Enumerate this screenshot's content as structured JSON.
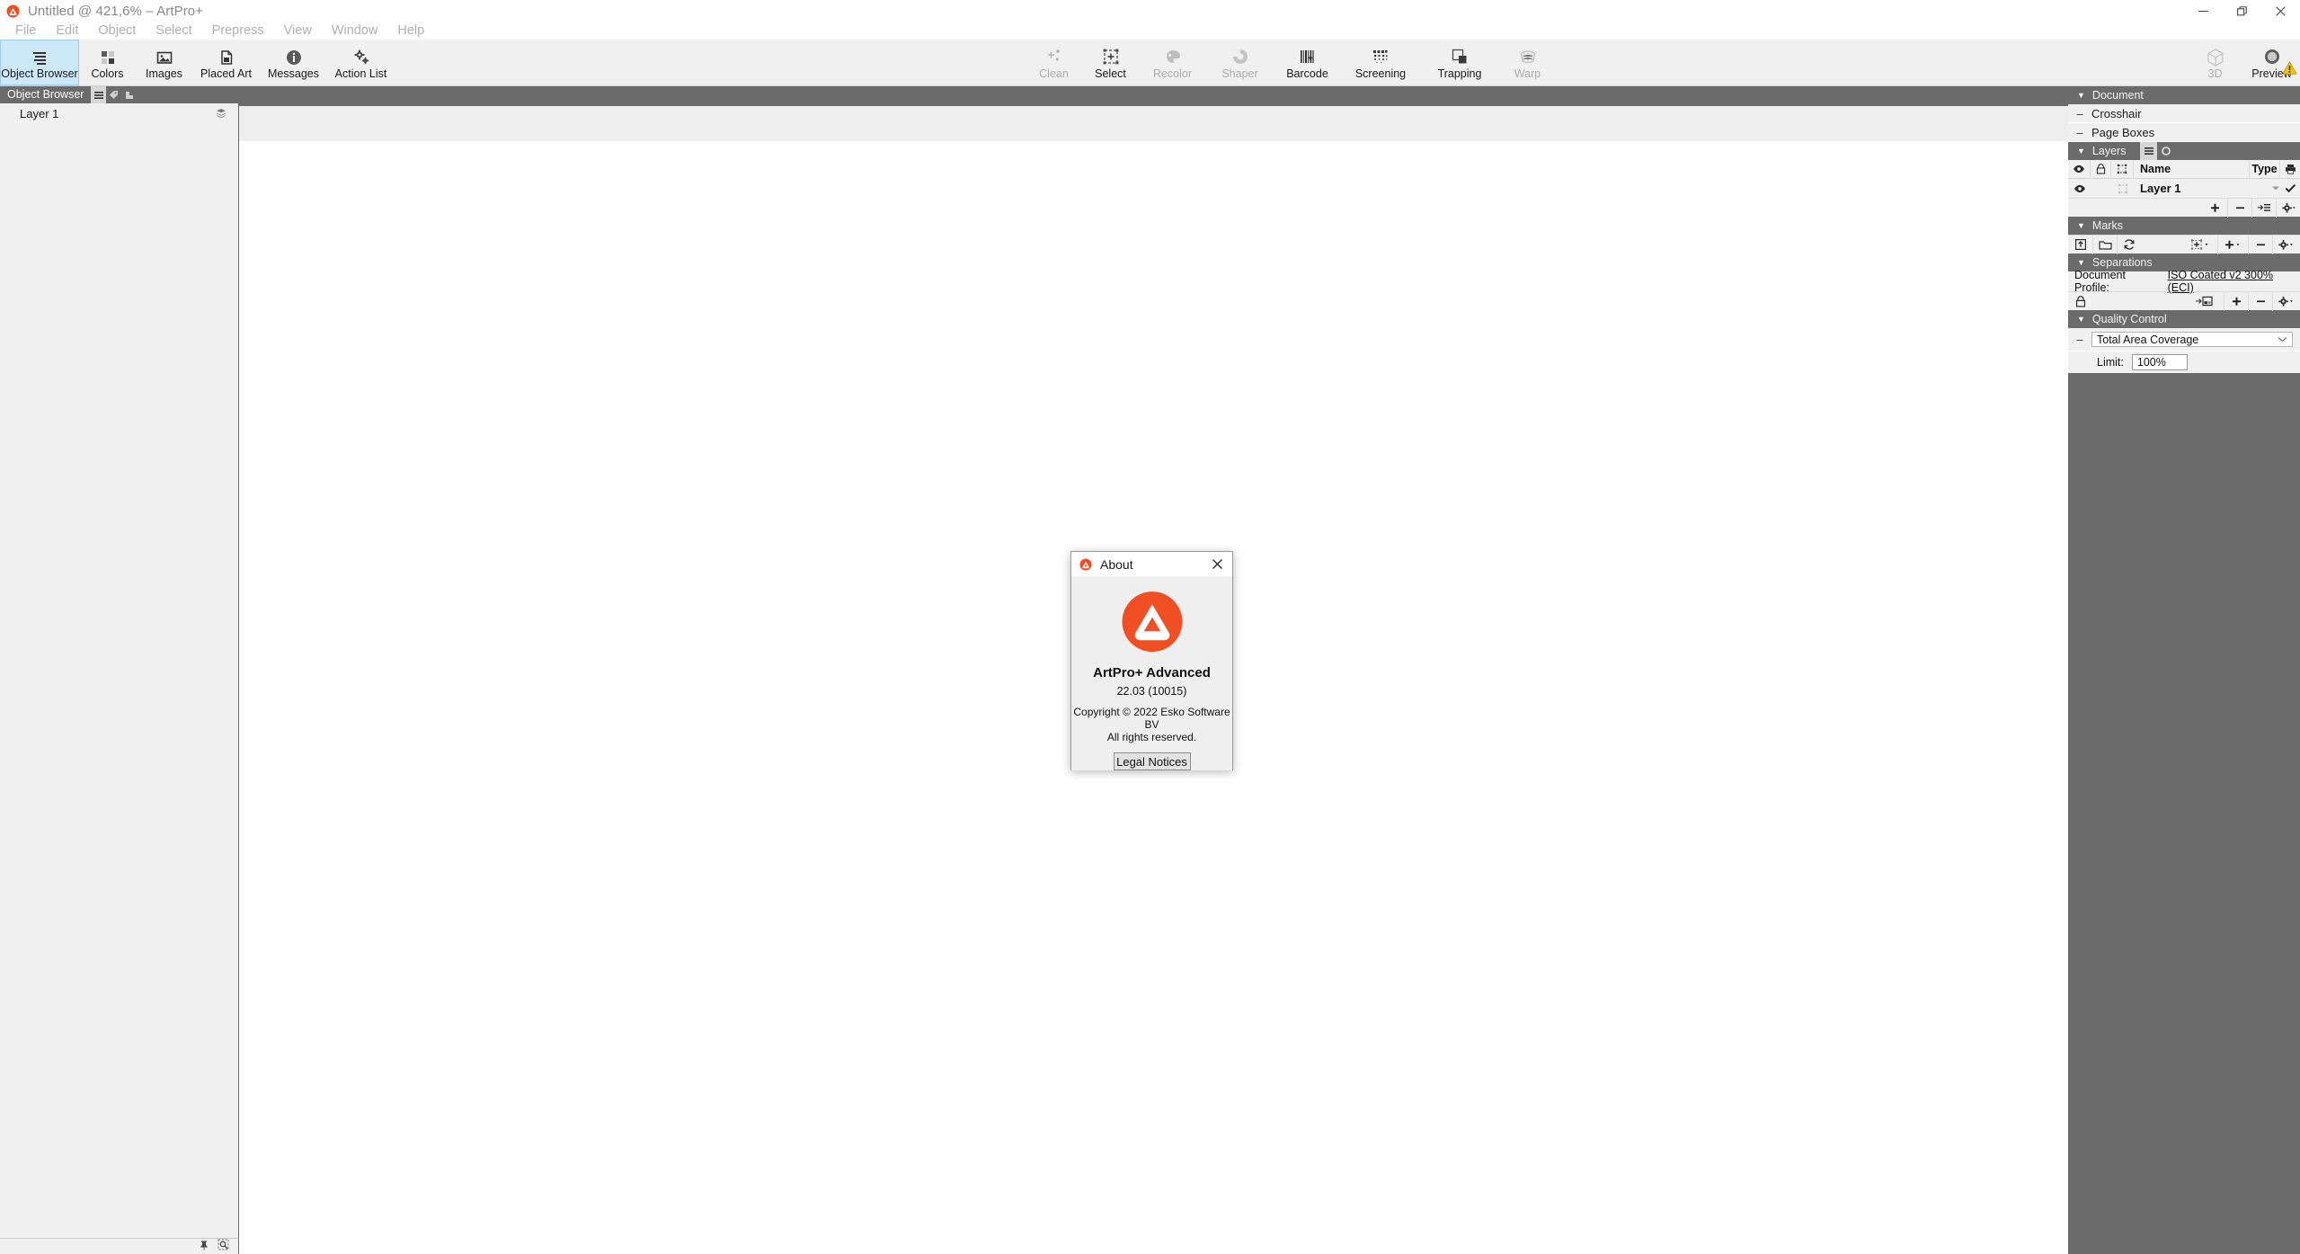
{
  "window": {
    "title": "Untitled @ 421,6% – ArtPro+",
    "logo_icon": "artpro-logo-icon",
    "controls": [
      {
        "name": "minimize-button",
        "glyph": "—"
      },
      {
        "name": "restore-button",
        "glyph": "❐"
      },
      {
        "name": "close-button",
        "glyph": "✕"
      }
    ]
  },
  "menubar": {
    "items": [
      {
        "label": "File"
      },
      {
        "label": "Edit"
      },
      {
        "label": "Object"
      },
      {
        "label": "Select"
      },
      {
        "label": "Prepress"
      },
      {
        "label": "View"
      },
      {
        "label": "Window"
      },
      {
        "label": "Help"
      }
    ]
  },
  "toolbar": {
    "left_group": [
      {
        "label": "Object Browser",
        "icon": "object-browser-icon",
        "active": true,
        "dim": false
      },
      {
        "label": "Colors",
        "icon": "colors-icon",
        "active": false,
        "dim": false
      },
      {
        "label": "Images",
        "icon": "images-icon",
        "active": false,
        "dim": false
      },
      {
        "label": "Placed Art",
        "icon": "placed-art-icon",
        "active": false,
        "dim": false
      },
      {
        "label": "Messages",
        "icon": "messages-icon",
        "active": false,
        "dim": false
      },
      {
        "label": "Action List",
        "icon": "action-list-icon",
        "active": false,
        "dim": false
      }
    ],
    "center_group": [
      {
        "label": "Clean",
        "icon": "clean-icon",
        "dim": true
      },
      {
        "label": "Select",
        "icon": "select-icon",
        "dim": false
      },
      {
        "label": "Recolor",
        "icon": "recolor-icon",
        "dim": true
      },
      {
        "label": "Shaper",
        "icon": "shaper-icon",
        "dim": true
      },
      {
        "label": "Barcode",
        "icon": "barcode-icon",
        "dim": false
      },
      {
        "label": "Screening",
        "icon": "screening-icon",
        "dim": false
      },
      {
        "label": "Trapping",
        "icon": "trapping-icon",
        "dim": false
      },
      {
        "label": "Warp",
        "icon": "warp-icon",
        "dim": true
      }
    ],
    "right_group": [
      {
        "label": "3D",
        "icon": "cube-3d-icon",
        "dim": true
      },
      {
        "label": "Preview",
        "icon": "preview-icon",
        "dim": false
      }
    ],
    "warning_badge_icon": "warning-triangle-icon"
  },
  "left_panel": {
    "tab_label": "Object Browser",
    "tab_icons": [
      {
        "name": "list-view-icon",
        "selected": true
      },
      {
        "name": "tag-icon",
        "selected": false
      },
      {
        "name": "corner-shape-icon",
        "selected": false
      }
    ],
    "rows": [
      {
        "label": "Layer 1",
        "icon": "layers-stack-icon"
      }
    ],
    "footer_icons": [
      {
        "name": "pin-icon"
      },
      {
        "name": "zoom-selection-icon"
      }
    ]
  },
  "right_panel": {
    "document": {
      "title": "Document",
      "rows": [
        {
          "label": "Crosshair",
          "collapse": "–"
        },
        {
          "label": "Page Boxes",
          "collapse": "–"
        }
      ]
    },
    "layers": {
      "title": "Layers",
      "tabs": [
        {
          "name": "layers-list-tab-icon",
          "selected": true
        },
        {
          "name": "layers-circle-tab-icon",
          "selected": false
        }
      ],
      "columns": [
        "",
        "",
        "",
        "Name",
        "Type",
        ""
      ],
      "column_icons": [
        "eye-icon",
        "lock-icon",
        "selection-frame-icon",
        "",
        "",
        "printer-icon"
      ],
      "rows": [
        {
          "visible_icon": "eye-icon",
          "lock_icon": "",
          "frame_icon": "selection-frame-icon",
          "name": "Layer 1",
          "type_icon": "chevron-down-icon",
          "print_icon": "check-icon"
        }
      ],
      "toolbar_icons": [
        "plus-icon",
        "minus-icon",
        "move-to-layer-icon",
        "gear-icon"
      ]
    },
    "marks": {
      "title": "Marks",
      "toolbar_left_icons": [
        "export-icon",
        "folder-icon",
        "refresh-icon"
      ],
      "toolbar_right_icons": [
        "add-mark-object-icon",
        "plus-icon",
        "minus-icon",
        "gear-icon"
      ]
    },
    "separations": {
      "title": "Separations",
      "profile_label": "Document Profile:",
      "profile_value": "ISO Coated v2 300% (ECI)",
      "lock_icon": "lock-icon",
      "toolbar_right_icons": [
        "map-separations-icon",
        "plus-icon",
        "minus-icon",
        "gear-icon"
      ]
    },
    "quality_control": {
      "title": "Quality Control",
      "check_name": "Total Area Coverage",
      "collapse": "–",
      "limit_label": "Limit:",
      "limit_value": "100%"
    }
  },
  "about_dialog": {
    "title": "About",
    "logo_icon": "artpro-logo-icon",
    "close_icon": "close-icon",
    "app_name": "ArtPro+ Advanced",
    "version": "22.03 (10015)",
    "copyright_line1": "Copyright © 2022 Esko Software BV",
    "copyright_line2": "All rights reserved.",
    "button_label": "Legal Notices"
  },
  "colors": {
    "brand_orange": "#f04e23",
    "panel_gray": "#6b6b6b",
    "light_gray": "#f0f0f0",
    "active_tab_blue": "#cde8f9",
    "warning_yellow": "#f5c518"
  }
}
